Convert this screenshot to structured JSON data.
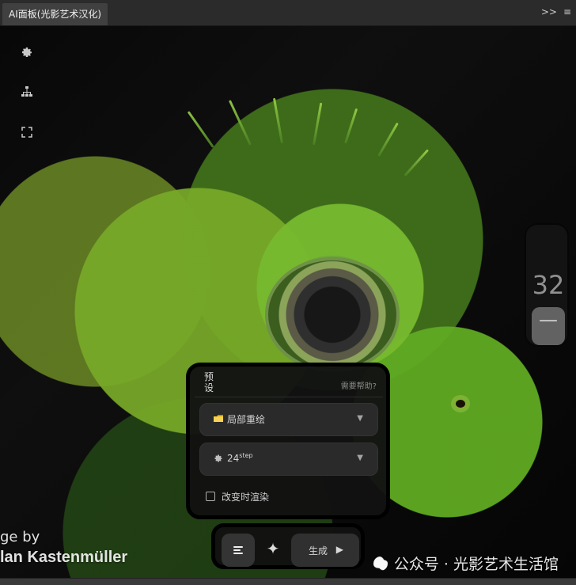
{
  "panel": {
    "tab_title": "AI面板(光影艺术汉化)",
    "top_actions": {
      "expand": ">>",
      "menu": "≡"
    }
  },
  "left_toolbar": {
    "settings_icon": "gear-icon",
    "hierarchy_icon": "hierarchy-icon",
    "fullscreen_icon": "fullscreen-icon"
  },
  "side_widget": {
    "value": "32",
    "minus_label": "—"
  },
  "preset_panel": {
    "title": "预设",
    "help_text": "需要帮助?",
    "dropdown1": {
      "icon": "folder-icon",
      "label": "局部重绘",
      "caret": "▼"
    },
    "dropdown2": {
      "icon": "gear-icon",
      "label_main": "24",
      "label_sup": "step",
      "caret": "▼"
    },
    "checkbox": {
      "checked": false,
      "label": "改变时渲染"
    }
  },
  "action_bar": {
    "menu_icon": "menu-icon",
    "spark_icon": "spark-icon",
    "generate_label": "生成",
    "play_icon": "play-icon"
  },
  "credit": {
    "line1": "ge by",
    "line2": "lan Kastenmüller"
  },
  "watermark": {
    "text": "公众号 · 光影艺术生活馆"
  },
  "colors": {
    "panel_bg": "#2b2b2b",
    "tab_bg": "#404040",
    "widget_bg": "#141414",
    "accent_folder": "#f1c232"
  }
}
